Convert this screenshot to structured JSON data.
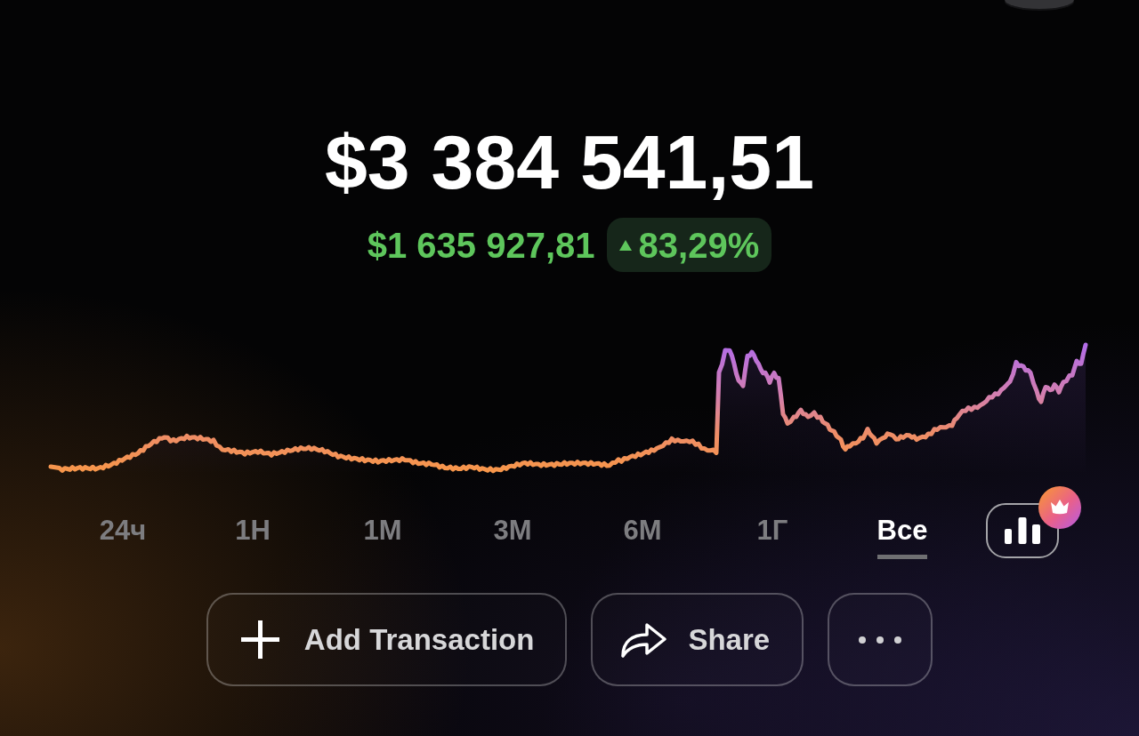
{
  "balance": {
    "total": "$3 384 541,51",
    "change_amount": "$1 635 927,81",
    "rising": true,
    "change_percent": "83,29%"
  },
  "periods": [
    {
      "label": "24ч",
      "selected": false
    },
    {
      "label": "1Н",
      "selected": false
    },
    {
      "label": "1М",
      "selected": false
    },
    {
      "label": "3М",
      "selected": false
    },
    {
      "label": "6М",
      "selected": false
    },
    {
      "label": "1Г",
      "selected": false
    },
    {
      "label": "Все",
      "selected": true
    }
  ],
  "chart_button": {
    "premium": true
  },
  "actions": [
    {
      "kind": "add",
      "label": "Add Transaction"
    },
    {
      "kind": "share",
      "label": "Share"
    },
    {
      "kind": "more"
    }
  ]
}
